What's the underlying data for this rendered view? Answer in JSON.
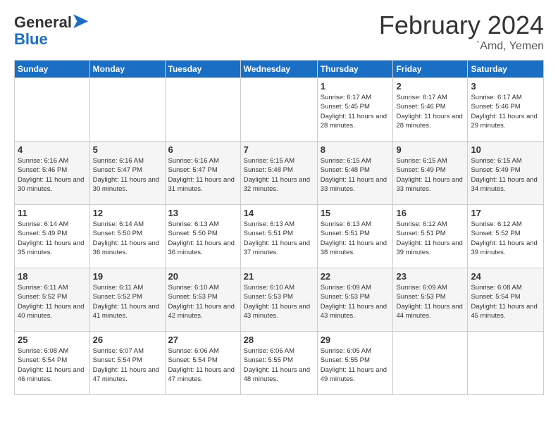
{
  "header": {
    "logo_line1": "General",
    "logo_line2": "Blue",
    "month": "February 2024",
    "location": "`Amd, Yemen"
  },
  "weekdays": [
    "Sunday",
    "Monday",
    "Tuesday",
    "Wednesday",
    "Thursday",
    "Friday",
    "Saturday"
  ],
  "weeks": [
    [
      {
        "day": "",
        "info": ""
      },
      {
        "day": "",
        "info": ""
      },
      {
        "day": "",
        "info": ""
      },
      {
        "day": "",
        "info": ""
      },
      {
        "day": "1",
        "info": "Sunrise: 6:17 AM\nSunset: 5:45 PM\nDaylight: 11 hours and 28 minutes."
      },
      {
        "day": "2",
        "info": "Sunrise: 6:17 AM\nSunset: 5:46 PM\nDaylight: 11 hours and 28 minutes."
      },
      {
        "day": "3",
        "info": "Sunrise: 6:17 AM\nSunset: 5:46 PM\nDaylight: 11 hours and 29 minutes."
      }
    ],
    [
      {
        "day": "4",
        "info": "Sunrise: 6:16 AM\nSunset: 5:46 PM\nDaylight: 11 hours and 30 minutes."
      },
      {
        "day": "5",
        "info": "Sunrise: 6:16 AM\nSunset: 5:47 PM\nDaylight: 11 hours and 30 minutes."
      },
      {
        "day": "6",
        "info": "Sunrise: 6:16 AM\nSunset: 5:47 PM\nDaylight: 11 hours and 31 minutes."
      },
      {
        "day": "7",
        "info": "Sunrise: 6:15 AM\nSunset: 5:48 PM\nDaylight: 11 hours and 32 minutes."
      },
      {
        "day": "8",
        "info": "Sunrise: 6:15 AM\nSunset: 5:48 PM\nDaylight: 11 hours and 33 minutes."
      },
      {
        "day": "9",
        "info": "Sunrise: 6:15 AM\nSunset: 5:49 PM\nDaylight: 11 hours and 33 minutes."
      },
      {
        "day": "10",
        "info": "Sunrise: 6:15 AM\nSunset: 5:49 PM\nDaylight: 11 hours and 34 minutes."
      }
    ],
    [
      {
        "day": "11",
        "info": "Sunrise: 6:14 AM\nSunset: 5:49 PM\nDaylight: 11 hours and 35 minutes."
      },
      {
        "day": "12",
        "info": "Sunrise: 6:14 AM\nSunset: 5:50 PM\nDaylight: 11 hours and 36 minutes."
      },
      {
        "day": "13",
        "info": "Sunrise: 6:13 AM\nSunset: 5:50 PM\nDaylight: 11 hours and 36 minutes."
      },
      {
        "day": "14",
        "info": "Sunrise: 6:13 AM\nSunset: 5:51 PM\nDaylight: 11 hours and 37 minutes."
      },
      {
        "day": "15",
        "info": "Sunrise: 6:13 AM\nSunset: 5:51 PM\nDaylight: 11 hours and 38 minutes."
      },
      {
        "day": "16",
        "info": "Sunrise: 6:12 AM\nSunset: 5:51 PM\nDaylight: 11 hours and 39 minutes."
      },
      {
        "day": "17",
        "info": "Sunrise: 6:12 AM\nSunset: 5:52 PM\nDaylight: 11 hours and 39 minutes."
      }
    ],
    [
      {
        "day": "18",
        "info": "Sunrise: 6:11 AM\nSunset: 5:52 PM\nDaylight: 11 hours and 40 minutes."
      },
      {
        "day": "19",
        "info": "Sunrise: 6:11 AM\nSunset: 5:52 PM\nDaylight: 11 hours and 41 minutes."
      },
      {
        "day": "20",
        "info": "Sunrise: 6:10 AM\nSunset: 5:53 PM\nDaylight: 11 hours and 42 minutes."
      },
      {
        "day": "21",
        "info": "Sunrise: 6:10 AM\nSunset: 5:53 PM\nDaylight: 11 hours and 43 minutes."
      },
      {
        "day": "22",
        "info": "Sunrise: 6:09 AM\nSunset: 5:53 PM\nDaylight: 11 hours and 43 minutes."
      },
      {
        "day": "23",
        "info": "Sunrise: 6:09 AM\nSunset: 5:53 PM\nDaylight: 11 hours and 44 minutes."
      },
      {
        "day": "24",
        "info": "Sunrise: 6:08 AM\nSunset: 5:54 PM\nDaylight: 11 hours and 45 minutes."
      }
    ],
    [
      {
        "day": "25",
        "info": "Sunrise: 6:08 AM\nSunset: 5:54 PM\nDaylight: 11 hours and 46 minutes."
      },
      {
        "day": "26",
        "info": "Sunrise: 6:07 AM\nSunset: 5:54 PM\nDaylight: 11 hours and 47 minutes."
      },
      {
        "day": "27",
        "info": "Sunrise: 6:06 AM\nSunset: 5:54 PM\nDaylight: 11 hours and 47 minutes."
      },
      {
        "day": "28",
        "info": "Sunrise: 6:06 AM\nSunset: 5:55 PM\nDaylight: 11 hours and 48 minutes."
      },
      {
        "day": "29",
        "info": "Sunrise: 6:05 AM\nSunset: 5:55 PM\nDaylight: 11 hours and 49 minutes."
      },
      {
        "day": "",
        "info": ""
      },
      {
        "day": "",
        "info": ""
      }
    ]
  ]
}
